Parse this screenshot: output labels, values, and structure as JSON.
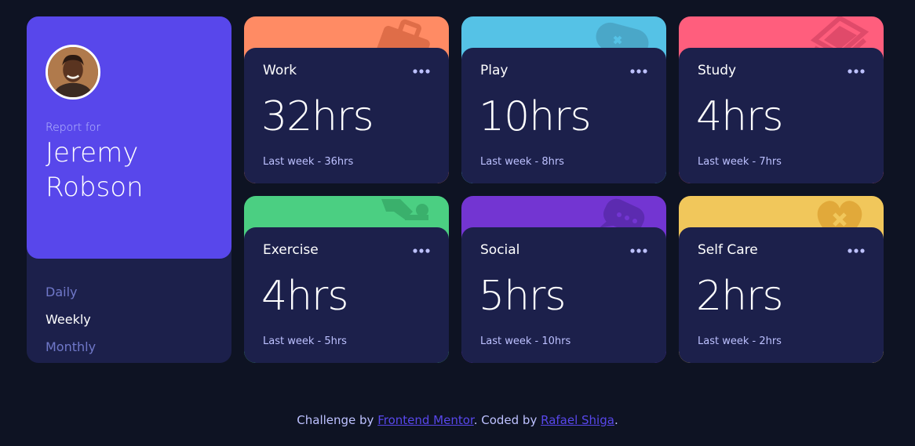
{
  "profile": {
    "report_for": "Report for",
    "first_name": "Jeremy",
    "last_name": "Robson",
    "avatar_icon": "avatar-photo",
    "periods": [
      {
        "label": "Daily",
        "active": false
      },
      {
        "label": "Weekly",
        "active": true
      },
      {
        "label": "Monthly",
        "active": false
      }
    ]
  },
  "activities": [
    {
      "title": "Work",
      "current": "32hrs",
      "previous": "Last week - 36hrs",
      "color": "#ff8b64",
      "icon": "briefcase-icon"
    },
    {
      "title": "Play",
      "current": "10hrs",
      "previous": "Last week - 8hrs",
      "color": "#55c2e6",
      "icon": "gamepad-icon"
    },
    {
      "title": "Study",
      "current": "4hrs",
      "previous": "Last week - 7hrs",
      "color": "#ff5e7d",
      "icon": "book-icon"
    },
    {
      "title": "Exercise",
      "current": "4hrs",
      "previous": "Last week - 5hrs",
      "color": "#4bcf82",
      "icon": "running-icon"
    },
    {
      "title": "Social",
      "current": "5hrs",
      "previous": "Last week - 10hrs",
      "color": "#7335d2",
      "icon": "chat-icon"
    },
    {
      "title": "Self Care",
      "current": "2hrs",
      "previous": "Last week - 2hrs",
      "color": "#f1c75b",
      "icon": "heart-icon"
    }
  ],
  "footer": {
    "prefix": "Challenge by ",
    "link1": "Frontend Mentor",
    "middle": ". Coded by ",
    "link2": "Rafael Shiga",
    "suffix": "."
  },
  "colors": {
    "background": "#0e1323",
    "card": "#1c204b",
    "accent": "#5847eb",
    "muted": "#7078c9",
    "pale": "#bdc1ff"
  }
}
